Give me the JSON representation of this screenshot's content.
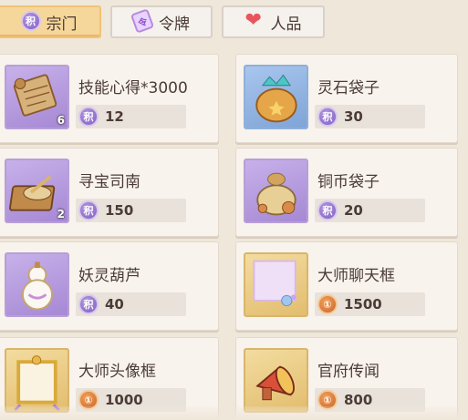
{
  "tabs": [
    {
      "label": "宗门",
      "icon": "sect-coin-icon",
      "icon_glyph": "积",
      "active": true
    },
    {
      "label": "令牌",
      "icon": "token-icon",
      "icon_glyph": "令",
      "active": false
    },
    {
      "label": "人品",
      "icon": "heart-icon",
      "icon_glyph": "❤",
      "active": false
    }
  ],
  "currency_glyphs": {
    "sect": "积",
    "copper": "①"
  },
  "items": [
    {
      "name": "技能心得*3000",
      "icon": "scroll-map-icon",
      "qty": "6",
      "currency": "sect",
      "price": "12",
      "frame": "purple"
    },
    {
      "name": "灵石袋子",
      "icon": "spirit-stone-bag-icon",
      "qty": "",
      "currency": "sect",
      "price": "30",
      "frame": "blue"
    },
    {
      "name": "寻宝司南",
      "icon": "compass-icon",
      "qty": "2",
      "currency": "sect",
      "price": "150",
      "frame": "purple"
    },
    {
      "name": "铜币袋子",
      "icon": "copper-coin-bag-icon",
      "qty": "",
      "currency": "sect",
      "price": "20",
      "frame": "purple"
    },
    {
      "name": "妖灵葫芦",
      "icon": "gourd-icon",
      "qty": "",
      "currency": "sect",
      "price": "40",
      "frame": "purple"
    },
    {
      "name": "大师聊天框",
      "icon": "chat-frame-icon",
      "qty": "",
      "currency": "copper",
      "price": "1500",
      "frame": "gold"
    },
    {
      "name": "大师头像框",
      "icon": "avatar-frame-icon",
      "qty": "",
      "currency": "copper",
      "price": "1000",
      "frame": "gold"
    },
    {
      "name": "官府传闻",
      "icon": "horn-icon",
      "qty": "",
      "currency": "copper",
      "price": "800",
      "frame": "gold"
    }
  ]
}
